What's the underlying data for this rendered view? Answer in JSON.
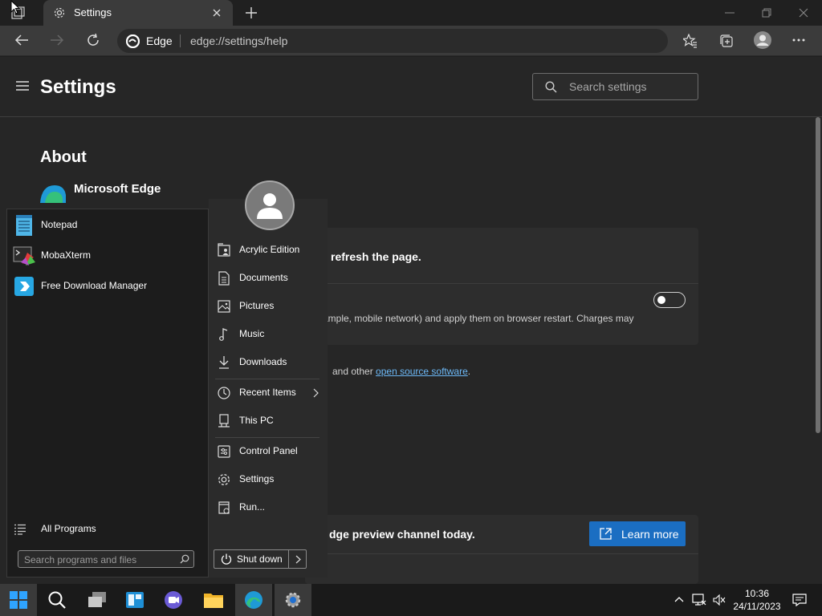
{
  "browser": {
    "tab_title": "Settings",
    "address_brand": "Edge",
    "address_url": "edge://settings/help"
  },
  "settings": {
    "title": "Settings",
    "search_placeholder": "Search settings",
    "about_heading": "About",
    "product_name": "Microsoft Edge",
    "refresh_text": "refresh the page.",
    "network_text": "ample, mobile network) and apply them on browser restart. Charges may",
    "oss_prefix": "and other ",
    "oss_link": "open source software",
    "oss_suffix": ".",
    "preview_text": "dge preview channel today.",
    "learn_more_label": "Learn more",
    "toggle_on": false
  },
  "start_menu": {
    "programs": [
      {
        "label": "Notepad",
        "icon": "notepad-icon"
      },
      {
        "label": "MobaXterm",
        "icon": "mobaxterm-icon"
      },
      {
        "label": "Free Download Manager",
        "icon": "fdm-icon"
      }
    ],
    "all_programs_label": "All Programs",
    "search_placeholder": "Search programs and files",
    "places": [
      {
        "label": "Acrylic Edition",
        "icon": "user-folder-icon"
      },
      {
        "label": "Documents",
        "icon": "document-icon"
      },
      {
        "label": "Pictures",
        "icon": "picture-icon"
      },
      {
        "label": "Music",
        "icon": "music-icon"
      },
      {
        "label": "Downloads",
        "icon": "download-icon"
      },
      {
        "label": "Recent Items",
        "icon": "clock-icon"
      },
      {
        "label": "This PC",
        "icon": "computer-icon"
      },
      {
        "label": "Control Panel",
        "icon": "control-panel-icon"
      },
      {
        "label": "Settings",
        "icon": "gear-icon"
      },
      {
        "label": "Run...",
        "icon": "run-icon"
      }
    ],
    "shutdown_label": "Shut down"
  },
  "taskbar": {
    "time": "10:36",
    "date": "24/11/2023"
  }
}
